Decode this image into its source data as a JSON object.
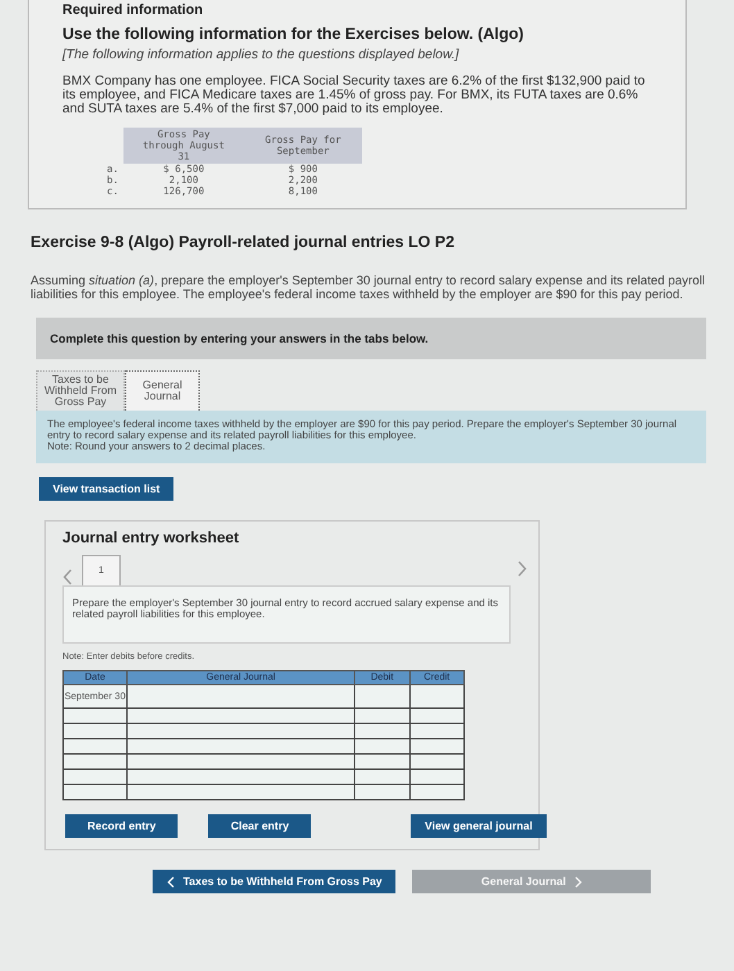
{
  "intro": {
    "heading": "Required information",
    "title": "Use the following information for the Exercises below. (Algo)",
    "note": "[The following information applies to the questions displayed below.]",
    "paragraph": "BMX Company has one employee. FICA Social Security taxes are 6.2% of the first $132,900 paid to its employee, and FICA Medicare taxes are 1.45% of gross pay. For BMX, its FUTA taxes are 0.6% and SUTA taxes are 5.4% of the first $7,000 paid to its employee.",
    "table": {
      "columns": [
        "Gross Pay through August 31",
        "Gross Pay for September"
      ],
      "rows": [
        {
          "label": "a.",
          "values": [
            "$ 6,500",
            "$ 900"
          ]
        },
        {
          "label": "b.",
          "values": [
            "2,100",
            "2,200"
          ]
        },
        {
          "label": "c.",
          "values": [
            "126,700",
            "8,100"
          ]
        }
      ]
    }
  },
  "exercise": {
    "title": "Exercise 9-8 (Algo) Payroll-related journal entries LO P2",
    "prompt": "Assuming *situation (a)*, prepare the employer's September 30 journal entry to record salary expense and its related payroll liabilities for this employee. The employee's federal income taxes withheld by the employer are $90 for this pay period."
  },
  "instruction": "Complete this question by entering your answers in the tabs below.",
  "tabs": [
    {
      "label": "Taxes to be Withheld From Gross Pay",
      "selected": false
    },
    {
      "label": "General Journal",
      "selected": true
    }
  ],
  "tab_panel": {
    "text": "The employee's federal income taxes withheld by the employer are $90 for this pay period. Prepare the employer's September 30 journal entry to record salary expense and its related payroll liabilities for this employee.",
    "note": "Note: Round your answers to 2 decimal places."
  },
  "view_transaction_button": "View transaction list",
  "worksheet": {
    "title": "Journal entry worksheet",
    "entries": [
      {
        "label": "1",
        "selected": true
      }
    ],
    "description": "Prepare the employer's September 30 journal entry to record accrued salary expense and its related payroll liabilities for this employee.",
    "note": "Note: Enter debits before credits.",
    "columns": [
      "Date",
      "General Journal",
      "Debit",
      "Credit"
    ],
    "rows": [
      {
        "date": "September 30"
      },
      {
        "date": null
      },
      {
        "date": null
      },
      {
        "date": null
      },
      {
        "date": null
      },
      {
        "date": null
      },
      {
        "date": null
      }
    ],
    "buttons": [
      "Record entry",
      "Clear entry",
      "View general journal"
    ]
  },
  "navigation": [
    {
      "label": "Taxes to be Withheld From Gross Pay",
      "kind": "prev",
      "disabled": false
    },
    {
      "label": "General Journal",
      "kind": "next",
      "disabled": true
    }
  ]
}
